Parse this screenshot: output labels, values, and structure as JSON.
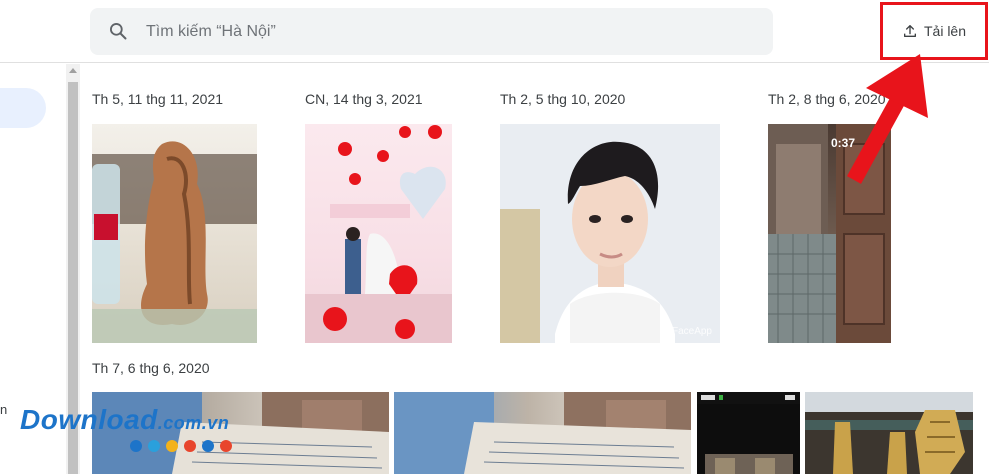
{
  "search": {
    "placeholder": "Tìm kiếm “Hà Nội”",
    "icon": "search-icon"
  },
  "toolbar": {
    "upload_label": "Tải lên",
    "upload_icon": "upload-icon",
    "highlight_color": "#e8141b"
  },
  "sidebar": {
    "partial_item_text": "n"
  },
  "groups": [
    {
      "date": "Th 5, 11 thg 11, 2021",
      "photo_kind": "wooden statue figurine"
    },
    {
      "date": "CN, 14 thg 3, 2021",
      "photo_kind": "wedding couple with red balloons"
    },
    {
      "date": "Th 2, 5 thg 10, 2020",
      "photo_kind": "portrait photo",
      "watermark": "FaceApp"
    },
    {
      "date": "Th 2, 8 thg 6, 2020",
      "video_duration": "0:37"
    },
    {
      "date": "Th 7, 6 thg 6, 2020"
    }
  ],
  "watermark": {
    "brand": "Download",
    "suffix": ".com.vn",
    "dot_colors": [
      "#1d74c9",
      "#2aa0dc",
      "#f3b21b",
      "#e8452c",
      "#1d74c9",
      "#e8452c"
    ]
  },
  "colors": {
    "accent_blue": "#1a73e8",
    "nav_selected": "#e8f0fe",
    "annotation_red": "#e8141b"
  }
}
